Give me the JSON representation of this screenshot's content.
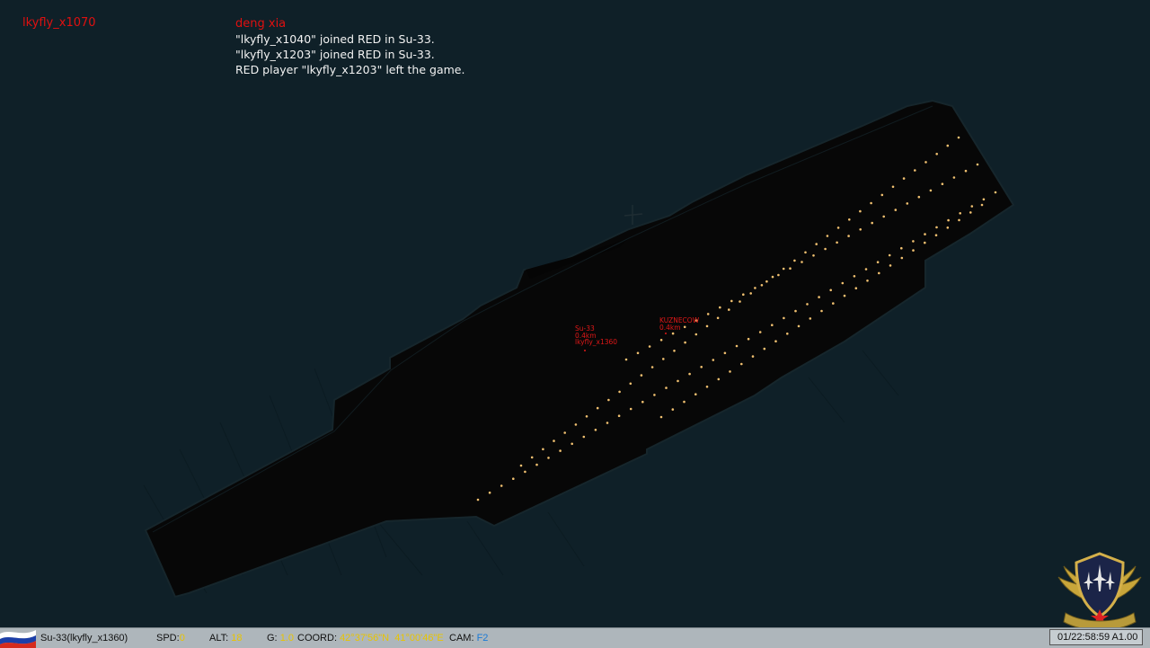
{
  "hud": {
    "player_tag": "lkyfly_x1070",
    "chat": {
      "sender": "deng xia",
      "lines": [
        "\"lkyfly_x1040\" joined RED in Su-33.",
        "\"lkyfly_x1203\" joined RED in Su-33.",
        "RED player \"lkyfly_x1203\" left the game."
      ]
    }
  },
  "markers": {
    "aircraft": {
      "line1": "Su-33",
      "line2": "0.4km",
      "line3": "lkyfly_x1360"
    },
    "ship": {
      "line1": "KUZNECOW",
      "line2": "0.4km"
    }
  },
  "statusbar": {
    "unit": "Su-33(lkyfly_x1360)",
    "spd_label": "SPD:",
    "spd_value": "0",
    "alt_label": "ALT:",
    "alt_value": "18",
    "g_label": "G:",
    "g_value": "1.0",
    "coord_label": "COORD:",
    "coord_value": "42°37'56\"N  41°00'46\"E",
    "cam_label": "CAM:",
    "cam_value": "F2",
    "time": "01/22:58:59 A1.00",
    "flag_colors": [
      "#ffffff",
      "#1c3fa8",
      "#d52b1e"
    ]
  },
  "colors": {
    "background": "#0f2028",
    "hull": "#070707",
    "deck_lights": "#f0c070",
    "marker_text": "#e01818",
    "hud_red": "#e01010"
  },
  "emblem": {
    "icon": "squadron-emblem-icon"
  }
}
